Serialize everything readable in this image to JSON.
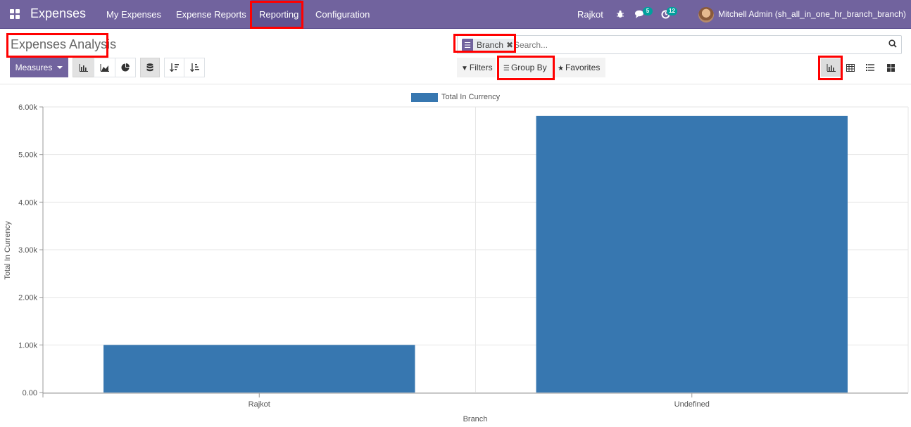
{
  "navbar": {
    "brand": "Expenses",
    "menu": [
      "My Expenses",
      "Expense Reports",
      "Reporting",
      "Configuration"
    ],
    "active_menu": "Reporting",
    "branch": "Rajkot",
    "messages_count": "5",
    "activities_count": "12",
    "user": "Mitchell Admin (sh_all_in_one_hr_branch_branch)"
  },
  "control_panel": {
    "title": "Expenses Analysis",
    "facet": "Branch",
    "search_placeholder": "Search...",
    "measures_label": "Measures",
    "filters_label": "Filters",
    "groupby_label": "Group By",
    "favorites_label": "Favorites"
  },
  "chart_data": {
    "type": "bar",
    "legend": "Total In Currency",
    "categories": [
      "Rajkot",
      "Undefined"
    ],
    "values": [
      1000,
      5810
    ],
    "ylabel": "Total In Currency",
    "xlabel": "Branch",
    "ylim": [
      0,
      6000
    ],
    "yticks": [
      "0.00",
      "1.00k",
      "2.00k",
      "3.00k",
      "4.00k",
      "5.00k",
      "6.00k"
    ],
    "color": "#3777b0",
    "grid": true,
    "legend_position": "top-center"
  },
  "colors": {
    "navbar": "#71639e",
    "highlight": "#ff0000",
    "badge": "#00a09d"
  }
}
